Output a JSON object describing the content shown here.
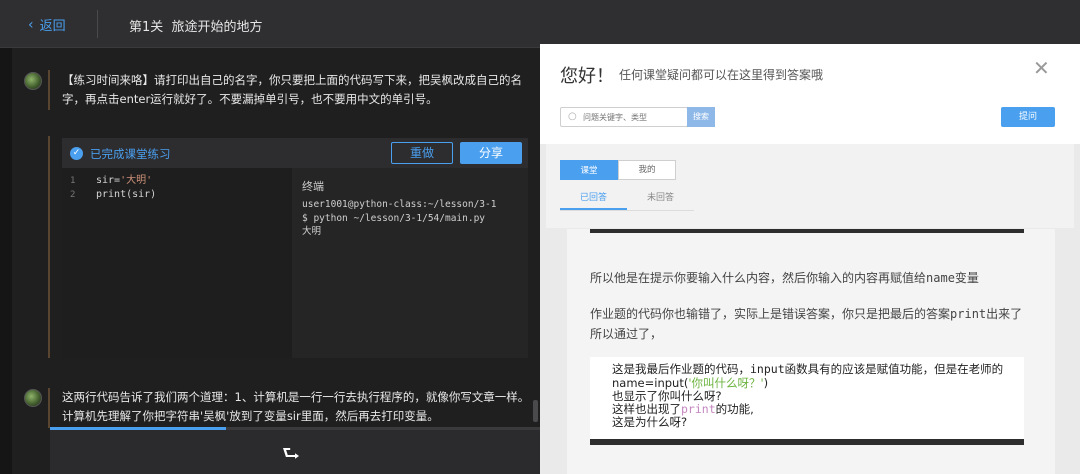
{
  "topbar": {
    "back_label": "返回",
    "lesson_title": "第1关  旅途开始的地方"
  },
  "chat": {
    "message1": "【练习时间来咯】请打印出自己的名字，你只要把上面的代码写下来，把吴枫改成自己的名字，再点击enter运行就好了。不要漏掉单引号，也不要用中文的单引号。",
    "message2": "这两行代码告诉了我们两个道理：1、计算机是一行一行去执行程序的，就像你写文章一样。计算机先理解了你把字符串'吴枫'放到了变量sir里面，然后再去打印变量。"
  },
  "exercise": {
    "status_label": "已完成课堂练习",
    "redo_label": "重做",
    "share_label": "分享",
    "code_lines": [
      {
        "num": "1",
        "pre": "sir=",
        "str": "'大明'"
      },
      {
        "num": "2",
        "pre": "print(sir)",
        "str": ""
      }
    ],
    "terminal_title": "终端",
    "terminal_output": "user1001@python-class:~/lesson/3-1\n$ python ~/lesson/3-1/54/main.py\n大明"
  },
  "progress": {
    "fraction": 0.36
  },
  "qa_panel": {
    "greeting": "您好！",
    "subtitle": "任何课堂疑问都可以在这里得到答案哦",
    "search_placeholder": "问题关键字、类型",
    "search_button": "搜索",
    "ask_button": "提问",
    "segments": [
      "课堂",
      "我的"
    ],
    "tabs": [
      "已回答",
      "未回答"
    ],
    "answer": {
      "p1_before": "所以他是在提示你要输入什么内容，然后你输入的内容再赋值给",
      "p1_code": "name",
      "p1_after": "变量",
      "p2_before": "作业题的代码你也输错了，实际上是错误答案，你只是把最后的答案",
      "p2_code": "print",
      "p2_after": "出来了所以通过了，",
      "snippet": {
        "line1_before": "这是我最后作业题的代码，",
        "line1_code": "input",
        "line1_after": "函数具有的应该是赋值功能，但是在老师的",
        "line2_before": "name=input(",
        "line2_str": "'你叫什么呀？'",
        "line2_after": ")",
        "line3": "也显示了你叫什么呀?",
        "line4_before": "这样也出现了",
        "line4_code": "print",
        "line4_after": "的功能,",
        "line5": "这是为什么呀?"
      }
    }
  },
  "colors": {
    "accent": "#4a9fef",
    "dark_bg": "#1b1b1c"
  }
}
